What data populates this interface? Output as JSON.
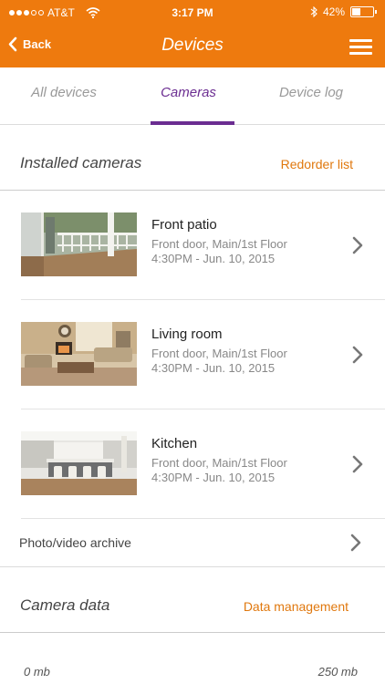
{
  "status_bar": {
    "signal_bars_filled": 3,
    "signal_bars_total": 5,
    "carrier": "AT&T",
    "time": "3:17 PM",
    "battery_percent": "42%",
    "battery_level": 0.42,
    "icons": [
      "wifi-icon",
      "bluetooth-icon",
      "battery-icon"
    ]
  },
  "nav": {
    "back_label": "Back",
    "title": "Devices",
    "menu_icon": "hamburger-menu-icon"
  },
  "tabs": [
    {
      "label": "All devices",
      "active": false
    },
    {
      "label": "Cameras",
      "active": true
    },
    {
      "label": "Device log",
      "active": false
    }
  ],
  "installed": {
    "title": "Installed cameras",
    "action_label": "Redorder list"
  },
  "cameras": [
    {
      "name": "Front patio",
      "location": "Front door, Main/1st Floor",
      "timestamp": "4:30PM - Jun. 10, 2015",
      "thumb": "front-patio-thumbnail"
    },
    {
      "name": "Living room",
      "location": "Front door, Main/1st Floor",
      "timestamp": "4:30PM - Jun. 10, 2015",
      "thumb": "living-room-thumbnail"
    },
    {
      "name": "Kitchen",
      "location": "Front door, Main/1st Floor",
      "timestamp": "4:30PM - Jun. 10, 2015",
      "thumb": "kitchen-thumbnail"
    }
  ],
  "archive": {
    "label": "Photo/video archive"
  },
  "camera_data": {
    "title": "Camera data",
    "action_label": "Data management",
    "min_label": "0 mb",
    "max_label": "250 mb"
  },
  "colors": {
    "accent": "#ee7a0e",
    "tab_active": "#6b2d91",
    "link": "#e0780e"
  }
}
